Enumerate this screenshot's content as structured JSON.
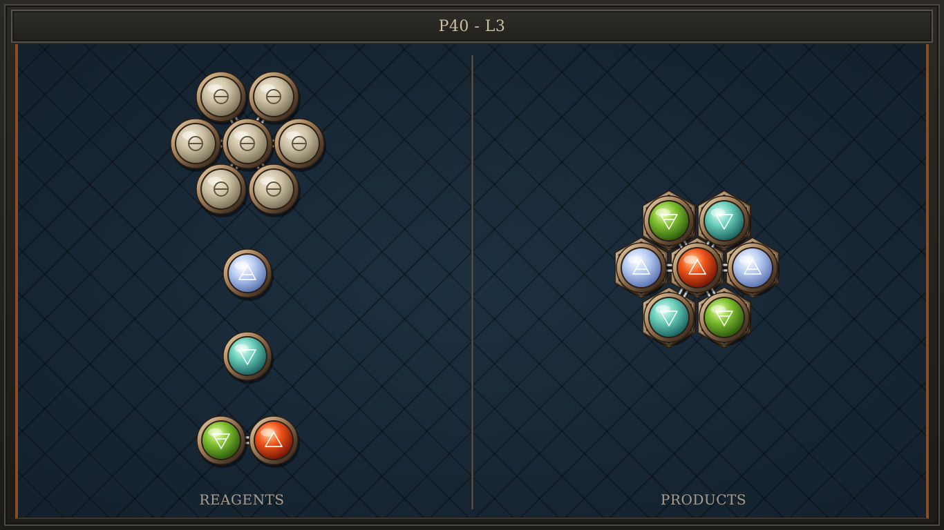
{
  "title": "P40 - L3",
  "panels": {
    "reagents_label": "REAGENTS",
    "products_label": "PRODUCTS"
  },
  "colors": {
    "board_background": "#182634",
    "frame_accent": "#8a4e22",
    "label_text": "#a79e8f",
    "title_text": "#cdbfa6"
  },
  "atom_types": {
    "salt": {
      "glyph": "salt-symbol",
      "light": "#f2ead6",
      "mid": "#cfc4a8",
      "dark": "#7d7358",
      "stroke": "#5e5442"
    },
    "air": {
      "glyph": "air-triangle",
      "light": "#ffffff",
      "mid": "#b9cdf2",
      "dark": "#5d76b4",
      "stroke": "#ffffff"
    },
    "water": {
      "glyph": "water-triangle",
      "light": "#e4fff4",
      "mid": "#68cdb9",
      "dark": "#1c6461",
      "stroke": "#ffffff"
    },
    "earth": {
      "glyph": "earth-triangle",
      "light": "#f0ffb0",
      "mid": "#7dbf2e",
      "dark": "#2f5c10",
      "stroke": "#ffffff"
    },
    "fire": {
      "glyph": "fire-triangle",
      "light": "#ffd39a",
      "mid": "#f0541a",
      "dark": "#7a1808",
      "stroke": "#ffffff"
    }
  },
  "reagents": [
    {
      "name": "reagent-salt-cluster",
      "atoms": [
        {
          "element": "salt"
        },
        {
          "element": "salt"
        },
        {
          "element": "salt"
        },
        {
          "element": "salt"
        },
        {
          "element": "salt"
        },
        {
          "element": "salt"
        },
        {
          "element": "salt"
        }
      ]
    },
    {
      "name": "reagent-air-atom",
      "atoms": [
        {
          "element": "air"
        }
      ]
    },
    {
      "name": "reagent-water-atom",
      "atoms": [
        {
          "element": "water"
        }
      ]
    },
    {
      "name": "reagent-earth-fire-pair",
      "atoms": [
        {
          "element": "earth"
        },
        {
          "element": "fire"
        }
      ]
    }
  ],
  "products": [
    {
      "name": "product-ring-molecule",
      "atoms": [
        {
          "element": "fire"
        },
        {
          "element": "earth"
        },
        {
          "element": "water"
        },
        {
          "element": "air"
        },
        {
          "element": "earth"
        },
        {
          "element": "water"
        },
        {
          "element": "air"
        }
      ]
    }
  ]
}
